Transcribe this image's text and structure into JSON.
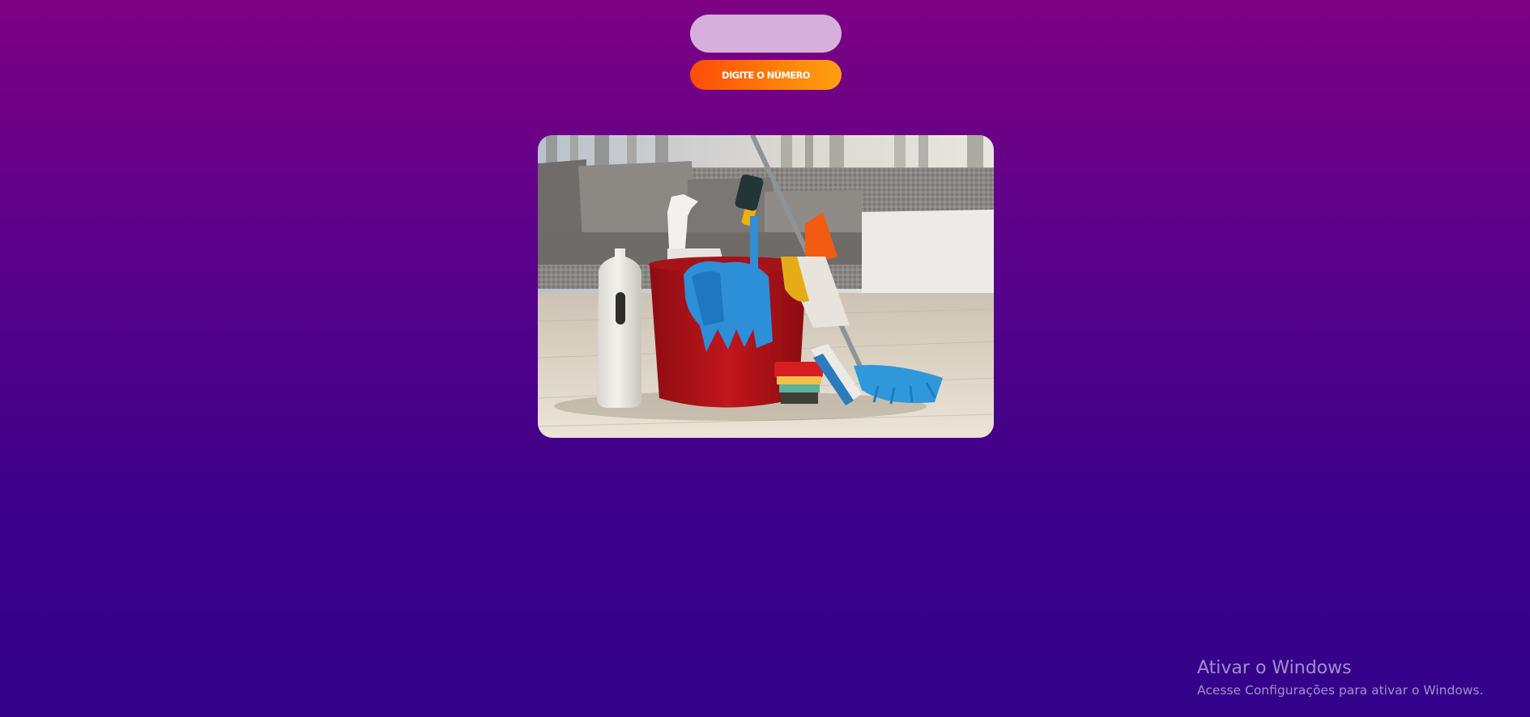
{
  "form": {
    "number_input": {
      "value": "",
      "placeholder": ""
    },
    "submit_label": "DIGITE O NÚMERO"
  },
  "image": {
    "subject": "cleaning supplies bucket on living room floor"
  },
  "watermark": {
    "title": "Ativar o Windows",
    "subtitle": "Acesse Configurações para ativar o Windows."
  },
  "colors": {
    "background_top": "#7e0183",
    "background_bottom": "#32028a",
    "input_bg": "#d6afdc",
    "button_start": "#ff4d06",
    "button_end": "#ff9f10"
  }
}
